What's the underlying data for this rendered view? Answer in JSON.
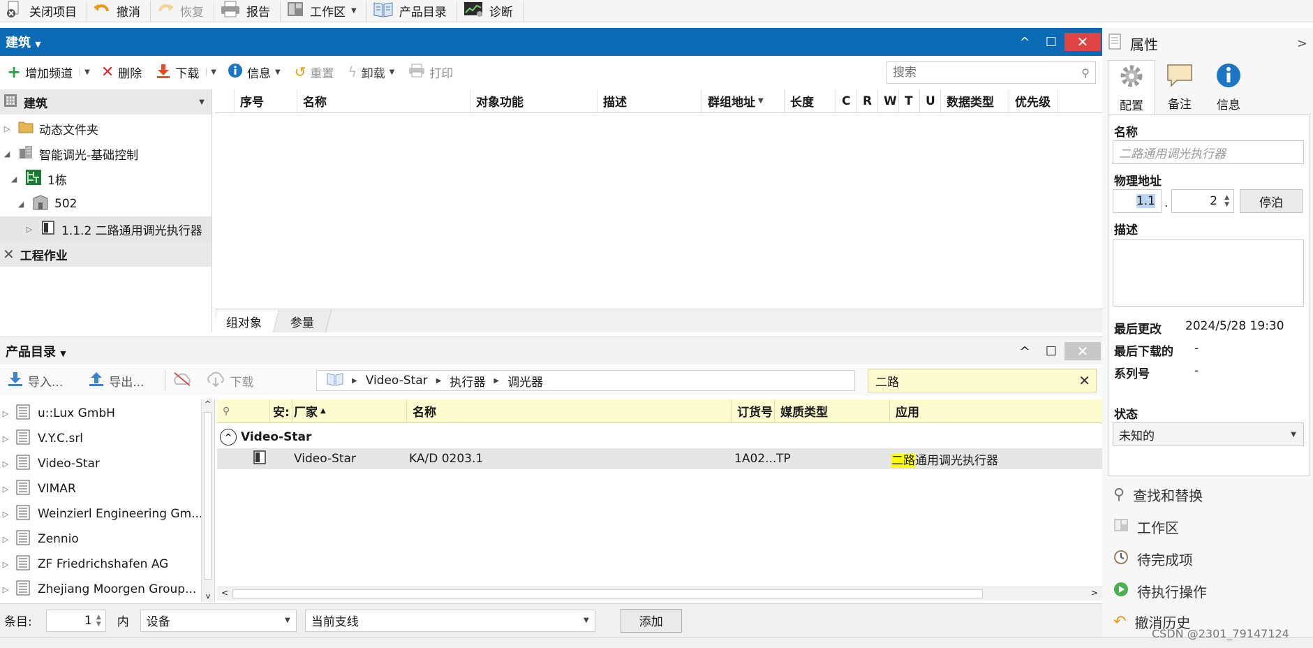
{
  "toolbar": {
    "close_project": "关闭项目",
    "undo": "撤消",
    "redo": "恢复",
    "report": "报告",
    "workspace": "工作区",
    "catalog": "产品目录",
    "diagnostics": "诊断"
  },
  "building_panel": {
    "title": "建筑",
    "actions": {
      "add_channel": "增加频道",
      "delete": "删除",
      "download": "下载",
      "info": "信息",
      "reset": "重置",
      "unload": "卸载",
      "print": "打印"
    },
    "search_placeholder": "搜索",
    "tree_header": "建筑",
    "tree": [
      {
        "label": "动态文件夹"
      },
      {
        "label": "智能调光-基础控制"
      },
      {
        "label": "1栋"
      },
      {
        "label": "502"
      },
      {
        "label": "1.1.2 二路通用调光执行器"
      }
    ],
    "engineering": "工程作业",
    "columns": [
      "序号",
      "名称",
      "对象功能",
      "描述",
      "群组地址",
      "长度",
      "C",
      "R",
      "W",
      "T",
      "U",
      "数据类型",
      "优先级"
    ],
    "tabs": [
      "组对象",
      "参量"
    ]
  },
  "catalog_panel": {
    "title": "产品目录",
    "actions": {
      "import": "导入...",
      "export": "导出...",
      "download": "下载"
    },
    "breadcrumb": [
      "Video-Star",
      "执行器",
      "调光器"
    ],
    "search_value": "二路",
    "manufacturers": [
      "u::Lux GmbH",
      "V.Y.C.srl",
      "Video-Star",
      "VIMAR",
      "Weinzierl Engineering Gm...",
      "Zennio",
      "ZF Friedrichshafen AG",
      "Zhejiang Moorgen Group..."
    ],
    "columns": [
      "安:",
      "厂家",
      "名称",
      "订货号",
      "媒质类型",
      "应用"
    ],
    "group_label": "Video-Star",
    "rows": [
      {
        "manufacturer": "Video-Star",
        "name": "KA/D 0203.1",
        "order_no": "1A02...",
        "medium": "TP",
        "app_highlight": "二路",
        "app_rest": "通用调光执行器"
      }
    ]
  },
  "bottom_bar": {
    "count_label": "条目:",
    "count_value": "1",
    "in_label": "内",
    "device_select": "设备",
    "line_select": "当前支线",
    "add_button": "添加"
  },
  "properties": {
    "title": "属性",
    "tabs": [
      "配置",
      "备注",
      "信息"
    ],
    "name_label": "名称",
    "name_placeholder": "二路通用调光执行器",
    "phys_label": "物理地址",
    "phys_prefix": "1.1",
    "phys_dot": ".",
    "phys_value": "2",
    "park_button": "停泊",
    "desc_label": "描述",
    "last_modified_label": "最后更改",
    "last_modified_value": "2024/5/28 19:30",
    "last_downloaded_label": "最后下载的",
    "last_downloaded_value": "-",
    "serial_label": "系列号",
    "serial_value": "-",
    "status_label": "状态",
    "status_value": "未知的",
    "side_links": [
      "查找和替换",
      "工作区",
      "待完成项",
      "待执行操作",
      "撤消历史"
    ]
  },
  "watermark": "CSDN @2301_79147124",
  "colors": {
    "header_blue": "#0a6ab4",
    "close_red": "#e04343",
    "catalog_yellow": "#fdfbd0",
    "highlight_yellow": "#ffff00",
    "selected_row": "#e6e6e6"
  }
}
